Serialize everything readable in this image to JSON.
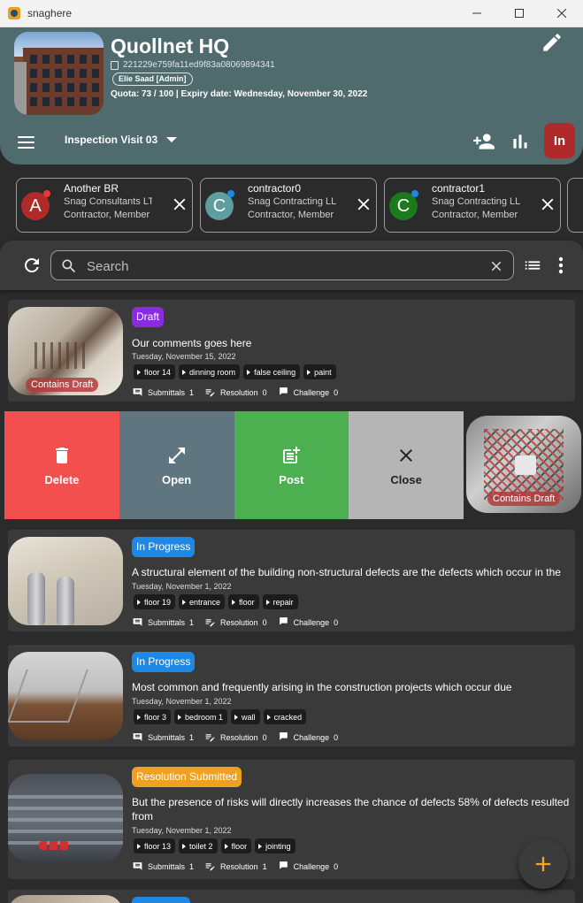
{
  "window": {
    "title": "snaghere"
  },
  "project": {
    "name": "Quollnet HQ",
    "id": "221229e759fa11ed9f83a08069894341",
    "user_chip": "Elie Saad [Admin]",
    "quota": "Quota: 73 / 100 | Expiry date: Wednesday, November 30, 2022"
  },
  "toolbar": {
    "visit": "Inspection Visit 03",
    "profile_initials": "In"
  },
  "members": [
    {
      "initial": "A",
      "name": "Another BR",
      "company": "Snag Consultants LTD",
      "role": "Contractor, Member",
      "avatar_color": "#b02a2a",
      "dot_color": "#e53935"
    },
    {
      "initial": "C",
      "name": "contractor0",
      "company": "Snag Contracting LLC",
      "role": "Contractor, Member",
      "avatar_color": "#5f9ea0",
      "dot_color": "#1e88e5"
    },
    {
      "initial": "C",
      "name": "contractor1",
      "company": "Snag Contracting LLC",
      "role": "Contractor, Member",
      "avatar_color": "#1b7a1b",
      "dot_color": "#1e88e5"
    }
  ],
  "search": {
    "placeholder": "Search"
  },
  "snags": [
    {
      "status": "Draft",
      "status_color": "#8a2be2",
      "description": "Our comments goes here",
      "date": "Tuesday, November 15, 2022",
      "tags": [
        "floor 14",
        "dinning room",
        "false ceiling",
        "paint"
      ],
      "overlay": "Contains Draft",
      "submittals_label": "Submittals",
      "submittals": "1",
      "resolution_label": "Resolution",
      "resolution": "0",
      "challenge_label": "Challenge",
      "challenge": "0"
    },
    {
      "status": "In Progress",
      "status_color": "#1e88e5",
      "description": "A structural element of the building non-structural defects are the defects which occur in the",
      "date": "Tuesday, November 1, 2022",
      "tags": [
        "floor 19",
        "entrance",
        "floor",
        "repair"
      ],
      "submittals_label": "Submittals",
      "submittals": "1",
      "resolution_label": "Resolution",
      "resolution": "0",
      "challenge_label": "Challenge",
      "challenge": "0"
    },
    {
      "status": "In Progress",
      "status_color": "#1e88e5",
      "description": "Most common and frequently arising in the construction projects which occur due",
      "date": "Tuesday, November 1, 2022",
      "tags": [
        "floor 3",
        "bedroom 1",
        "wall",
        "cracked"
      ],
      "submittals_label": "Submittals",
      "submittals": "1",
      "resolution_label": "Resolution",
      "resolution": "0",
      "challenge_label": "Challenge",
      "challenge": "0"
    },
    {
      "status": "Resolution Submitted",
      "status_color": "#f0a020",
      "description": "But the presence of risks will directly increases the chance of defects 58% of defects resulted from",
      "date": "Tuesday, November 1, 2022",
      "tags": [
        "floor 13",
        "toilet 2",
        "floor",
        "jointing"
      ],
      "submittals_label": "Submittals",
      "submittals": "1",
      "resolution_label": "Resolution",
      "resolution": "1",
      "challenge_label": "Challenge",
      "challenge": "0"
    }
  ],
  "swipe_actions": [
    {
      "label": "Delete",
      "color": "#f44f4f",
      "icon": "trash-icon"
    },
    {
      "label": "Open",
      "color": "#5f7680",
      "icon": "expand-icon"
    },
    {
      "label": "Post",
      "color": "#4caf50",
      "icon": "post-add-icon"
    },
    {
      "label": "Close",
      "color": "#b5b5b5",
      "icon": "close-icon"
    }
  ],
  "swipe_overlay": "Contains Draft"
}
